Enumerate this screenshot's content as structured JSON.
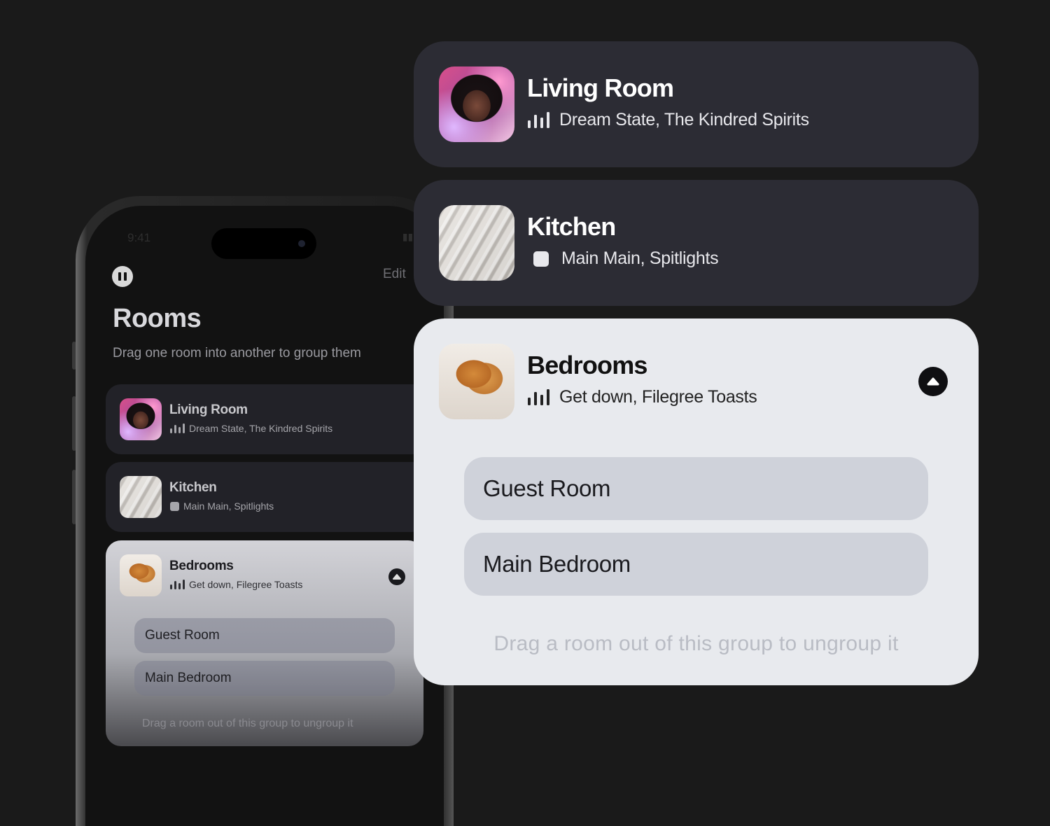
{
  "phone": {
    "status_time": "9:41",
    "edit_label": "Edit",
    "title": "Rooms",
    "subtitle": "Drag one room into another to group them",
    "rooms": [
      {
        "name": "Living Room",
        "playing": "Dream State, The Kindred Spirits",
        "status_icon": "equalizer-bars-icon"
      },
      {
        "name": "Kitchen",
        "playing": "Main Main, Spitlights",
        "status_icon": "stop-icon"
      }
    ],
    "group": {
      "name": "Bedrooms",
      "playing": "Get down, Filegree Toasts",
      "status_icon": "equalizer-bars-icon",
      "members": [
        "Guest Room",
        "Main Bedroom"
      ],
      "hint": "Drag a room out of this group to ungroup it"
    }
  },
  "cards": {
    "living_room": {
      "name": "Living Room",
      "playing": "Dream State, The Kindred Spirits",
      "status_icon": "equalizer-bars-icon"
    },
    "kitchen": {
      "name": "Kitchen",
      "playing": "Main Main, Spitlights",
      "status_icon": "stop-icon"
    },
    "bedrooms": {
      "name": "Bedrooms",
      "playing": "Get down, Filegree Toasts",
      "status_icon": "equalizer-bars-icon",
      "members": [
        "Guest Room",
        "Main Bedroom"
      ],
      "hint": "Drag a room out of this group to ungroup it"
    }
  },
  "colors": {
    "background": "#1a1a1a",
    "dark_card": "#2c2c34",
    "light_card": "#e8eaee",
    "pill": "#cfd2da",
    "hint_text": "#b9bcc4"
  }
}
